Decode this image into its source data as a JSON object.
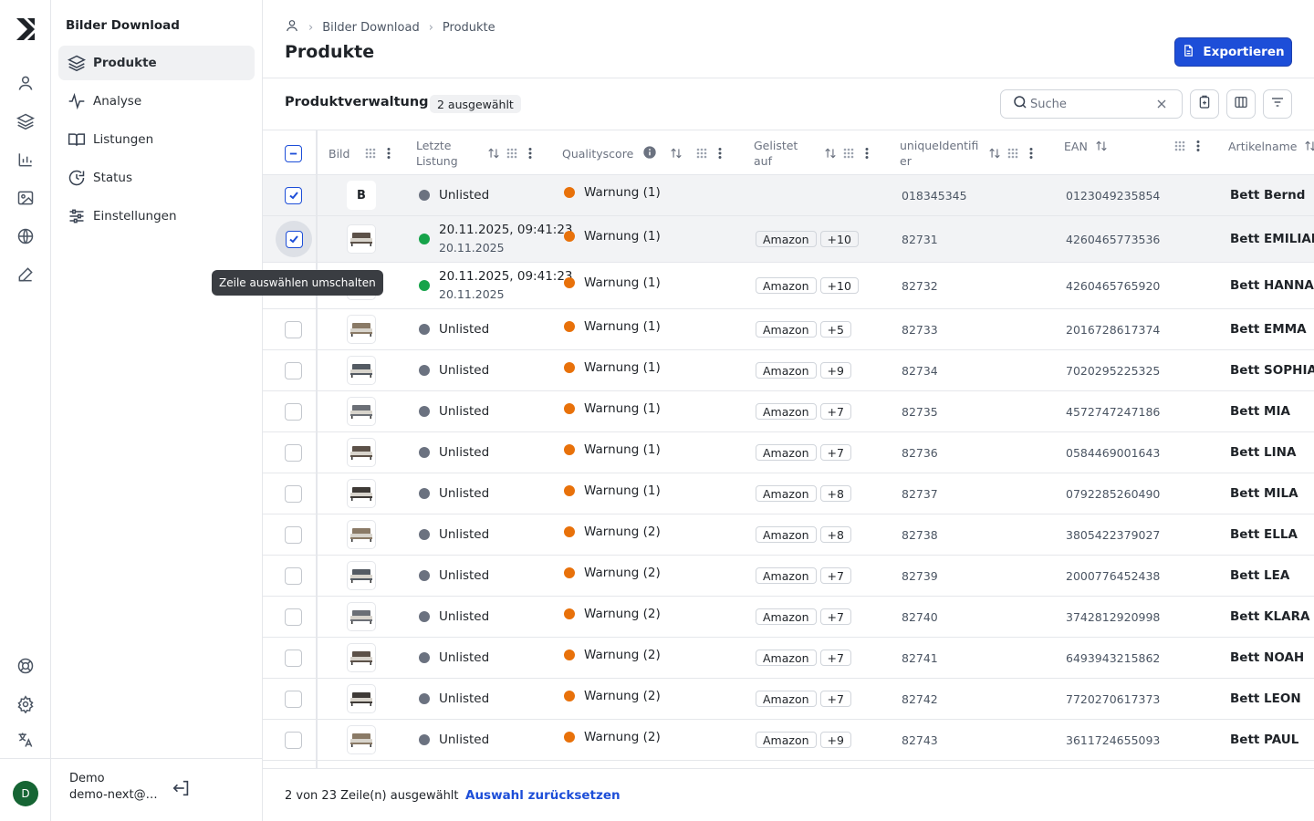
{
  "sidebar": {
    "title": "Bilder Download",
    "items": [
      {
        "label": "Produkte",
        "icon": "layers-icon",
        "active": true
      },
      {
        "label": "Analyse",
        "icon": "activity-icon"
      },
      {
        "label": "Listungen",
        "icon": "book-open-icon"
      },
      {
        "label": "Status",
        "icon": "refresh-clock-icon"
      },
      {
        "label": "Einstellungen",
        "icon": "sliders-icon"
      }
    ],
    "user": {
      "name": "Demo",
      "email": "demo-next@s...",
      "initial": "D"
    }
  },
  "breadcrumb": {
    "items": [
      "Bilder Download",
      "Produkte"
    ]
  },
  "page": {
    "title": "Produkte",
    "export_label": "Exportieren"
  },
  "toolbar": {
    "title": "Produktverwaltung",
    "selected_badge": "2 ausgewählt",
    "search_placeholder": "Suche"
  },
  "table": {
    "columns": [
      "Bild",
      "Letzte Listung",
      "Qualityscore",
      "Gelistet auf",
      "uniqueIdentifier",
      "EAN",
      "Artikelname"
    ],
    "rows": [
      {
        "checked": true,
        "image_letter": "B",
        "status": "Unlisted",
        "status_sub": "",
        "status_color": "gray",
        "quality": "Warnung (1)",
        "marketplace": "",
        "more": "",
        "uid": "018345345",
        "ean": "0123049235854",
        "name": "Bett Bernd"
      },
      {
        "checked": true,
        "image_letter": "",
        "status": "20.11.2025, 09:41:23",
        "status_sub": "20.11.2025",
        "status_color": "green",
        "quality": "Warnung (1)",
        "marketplace": "Amazon",
        "more": "+10",
        "uid": "82731",
        "ean": "4260465773536",
        "name": "Bett EMILIAN"
      },
      {
        "checked": false,
        "image_letter": "",
        "status": "20.11.2025, 09:41:23",
        "status_sub": "20.11.2025",
        "status_color": "green",
        "quality": "Warnung (1)",
        "marketplace": "Amazon",
        "more": "+10",
        "uid": "82732",
        "ean": "4260465765920",
        "name": "Bett HANNA"
      },
      {
        "checked": false,
        "image_letter": "",
        "status": "Unlisted",
        "status_sub": "",
        "status_color": "gray",
        "quality": "Warnung (1)",
        "marketplace": "Amazon",
        "more": "+5",
        "uid": "82733",
        "ean": "2016728617374",
        "name": "Bett EMMA"
      },
      {
        "checked": false,
        "image_letter": "",
        "status": "Unlisted",
        "status_sub": "",
        "status_color": "gray",
        "quality": "Warnung (1)",
        "marketplace": "Amazon",
        "more": "+9",
        "uid": "82734",
        "ean": "7020295225325",
        "name": "Bett SOPHIA"
      },
      {
        "checked": false,
        "image_letter": "",
        "status": "Unlisted",
        "status_sub": "",
        "status_color": "gray",
        "quality": "Warnung (1)",
        "marketplace": "Amazon",
        "more": "+7",
        "uid": "82735",
        "ean": "4572747247186",
        "name": "Bett MIA"
      },
      {
        "checked": false,
        "image_letter": "",
        "status": "Unlisted",
        "status_sub": "",
        "status_color": "gray",
        "quality": "Warnung (1)",
        "marketplace": "Amazon",
        "more": "+7",
        "uid": "82736",
        "ean": "0584469001643",
        "name": "Bett LINA"
      },
      {
        "checked": false,
        "image_letter": "",
        "status": "Unlisted",
        "status_sub": "",
        "status_color": "gray",
        "quality": "Warnung (1)",
        "marketplace": "Amazon",
        "more": "+8",
        "uid": "82737",
        "ean": "0792285260490",
        "name": "Bett MILA"
      },
      {
        "checked": false,
        "image_letter": "",
        "status": "Unlisted",
        "status_sub": "",
        "status_color": "gray",
        "quality": "Warnung (2)",
        "marketplace": "Amazon",
        "more": "+8",
        "uid": "82738",
        "ean": "3805422379027",
        "name": "Bett ELLA"
      },
      {
        "checked": false,
        "image_letter": "",
        "status": "Unlisted",
        "status_sub": "",
        "status_color": "gray",
        "quality": "Warnung (2)",
        "marketplace": "Amazon",
        "more": "+7",
        "uid": "82739",
        "ean": "2000776452438",
        "name": "Bett LEA"
      },
      {
        "checked": false,
        "image_letter": "",
        "status": "Unlisted",
        "status_sub": "",
        "status_color": "gray",
        "quality": "Warnung (2)",
        "marketplace": "Amazon",
        "more": "+7",
        "uid": "82740",
        "ean": "3742812920998",
        "name": "Bett KLARA"
      },
      {
        "checked": false,
        "image_letter": "",
        "status": "Unlisted",
        "status_sub": "",
        "status_color": "gray",
        "quality": "Warnung (2)",
        "marketplace": "Amazon",
        "more": "+7",
        "uid": "82741",
        "ean": "6493943215862",
        "name": "Bett NOAH"
      },
      {
        "checked": false,
        "image_letter": "",
        "status": "Unlisted",
        "status_sub": "",
        "status_color": "gray",
        "quality": "Warnung (2)",
        "marketplace": "Amazon",
        "more": "+7",
        "uid": "82742",
        "ean": "7720270617373",
        "name": "Bett LEON"
      },
      {
        "checked": false,
        "image_letter": "",
        "status": "Unlisted",
        "status_sub": "",
        "status_color": "gray",
        "quality": "Warnung (2)",
        "marketplace": "Amazon",
        "more": "+9",
        "uid": "82743",
        "ean": "3611724655093",
        "name": "Bett PAUL"
      }
    ]
  },
  "tooltip": "Zeile auswählen umschalten",
  "footer": {
    "selection_info": "2 von 23 Zeile(n) ausgewählt",
    "reset_label": "Auswahl zurücksetzen"
  },
  "colors": {
    "accent": "#1d4ed8",
    "listed": "#16a34a",
    "warning": "#e8710a",
    "unlisted": "#6b7280"
  }
}
